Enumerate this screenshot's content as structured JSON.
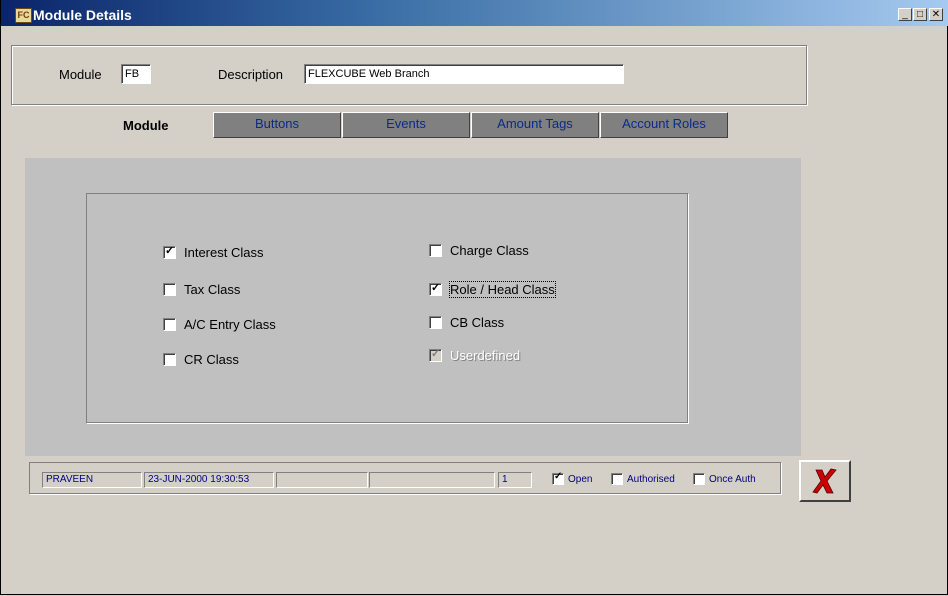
{
  "window": {
    "title": "Module Details",
    "app_icon_text": "FC"
  },
  "controls": {
    "minimize": "_",
    "maximize": "□",
    "close": "✕"
  },
  "header": {
    "module_label": "Module",
    "module_value": "FB",
    "description_label": "Description",
    "description_value": "FLEXCUBE Web Branch"
  },
  "tabs": {
    "active": "Module",
    "items": [
      "Buttons",
      "Events",
      "Amount Tags",
      "Account Roles"
    ]
  },
  "classes": {
    "left": [
      {
        "label": "Interest Class",
        "checked": true
      },
      {
        "label": "Tax Class",
        "checked": false
      },
      {
        "label": "A/C Entry Class",
        "checked": false
      },
      {
        "label": "CR Class",
        "checked": false
      }
    ],
    "right": [
      {
        "label": "Charge Class",
        "checked": false
      },
      {
        "label": "Role / Head Class",
        "checked": true
      },
      {
        "label": "CB Class",
        "checked": false
      },
      {
        "label": "Userdefined",
        "checked": true,
        "disabled": true
      }
    ]
  },
  "status": {
    "user": "PRAVEEN",
    "datetime": "23-JUN-2000 19:30:53",
    "field3": "",
    "field4": "",
    "count": "1",
    "open_label": "Open",
    "open_checked": true,
    "authorised_label": "Authorised",
    "authorised_checked": false,
    "once_auth_label": "Once Auth",
    "once_auth_checked": false
  },
  "colors": {
    "title_bar": "#0a246a",
    "tab_text": "#0a2a8a",
    "exit_icon": "#cc0000"
  }
}
